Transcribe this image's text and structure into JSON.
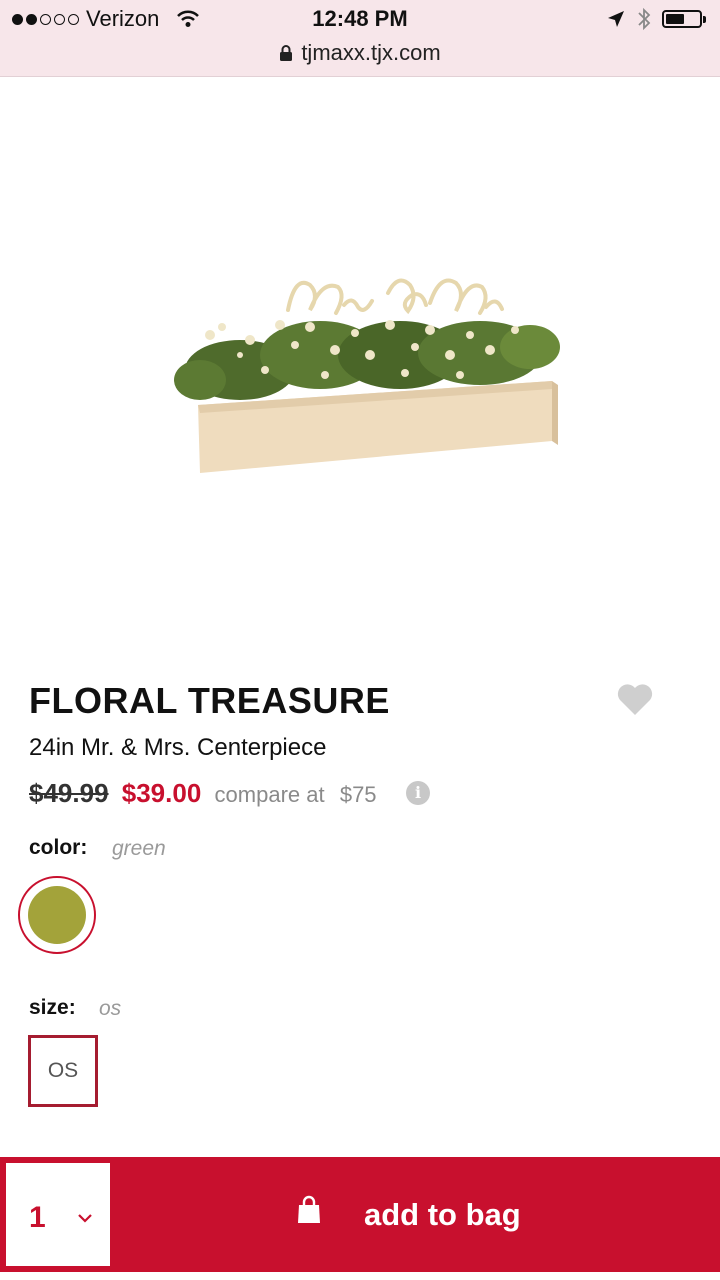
{
  "status_bar": {
    "carrier": "Verizon",
    "time": "12:48 PM",
    "signal_bars_full": 2,
    "signal_bars_total": 5,
    "battery_level": 0.55
  },
  "browser": {
    "url": "tjmaxx.tjx.com"
  },
  "product": {
    "brand": "FLORAL TREASURE",
    "name": "24in Mr. & Mrs. Centerpiece",
    "original_price": "$49.99",
    "sale_price": "$39.00",
    "compare_label": "compare at",
    "compare_price": "$75",
    "color_label": "color:",
    "color_value": "green",
    "size_label": "size:",
    "size_value": "os",
    "size_option": "OS"
  },
  "cart": {
    "quantity": "1",
    "add_label": "add to bag"
  },
  "icons": [
    "lock-icon",
    "wifi-icon",
    "location-arrow-icon",
    "bluetooth-icon",
    "battery-icon",
    "heart-icon",
    "info-icon",
    "chevron-down-icon",
    "shopping-bag-icon"
  ],
  "colors": {
    "brand_red": "#c8102e",
    "swatch_green": "#a3a33a",
    "status_bar_bg": "#f7e6ea"
  }
}
